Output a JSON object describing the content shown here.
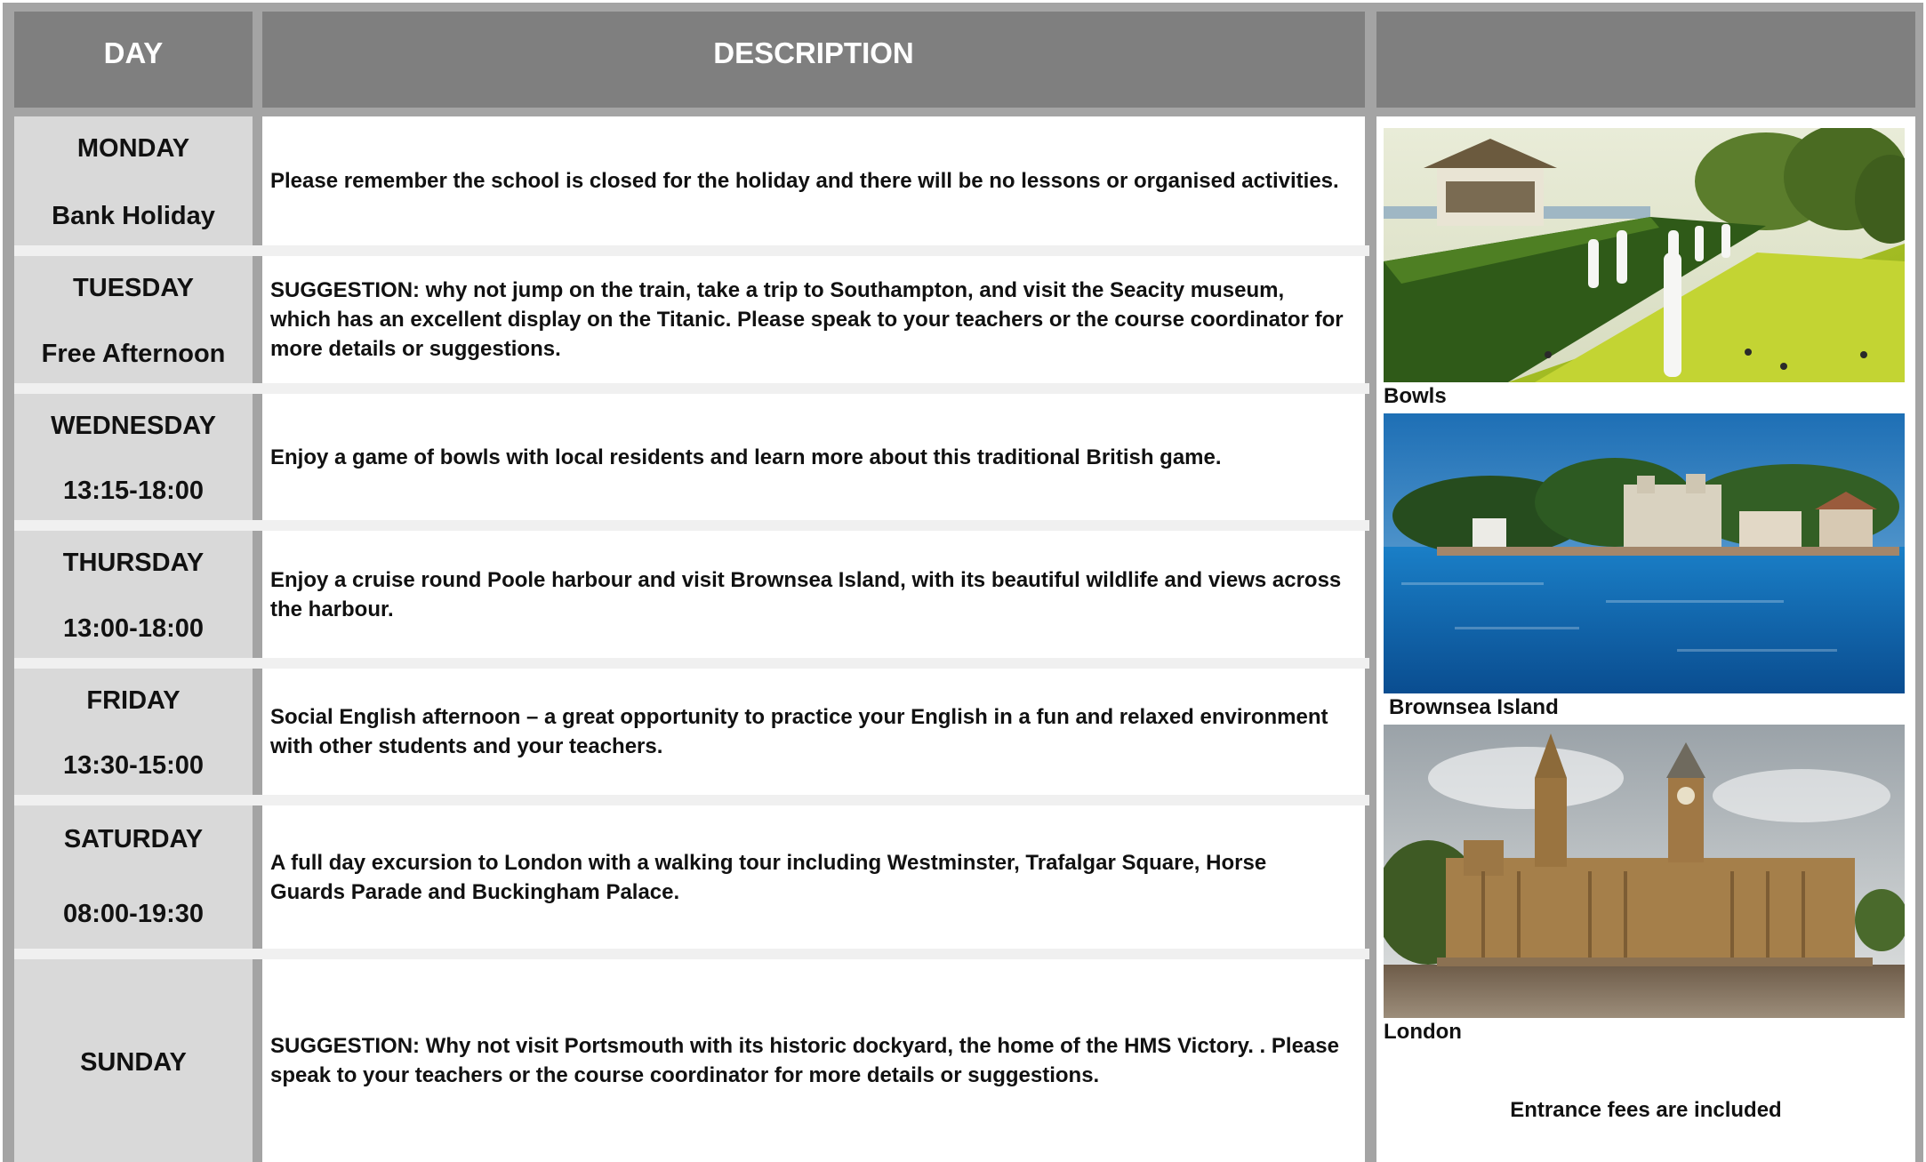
{
  "header": {
    "day": "DAY",
    "description": "DESCRIPTION",
    "pictures": ""
  },
  "rows": [
    {
      "day": "MONDAY",
      "sub": "Bank Holiday",
      "description": "Please remember the school is closed for the holiday and there will be no lessons or organised activities."
    },
    {
      "day": "TUESDAY",
      "sub": "Free Afternoon",
      "description": "SUGGESTION: why not jump on the train, take a trip to Southampton, and visit the Seacity museum, which has an excellent display on the Titanic. Please speak to your teachers or the course coordinator for more details or suggestions."
    },
    {
      "day": "WEDNESDAY",
      "sub": "13:15-18:00",
      "description": "Enjoy a game of bowls with local residents and learn more about this traditional British game."
    },
    {
      "day": "THURSDAY",
      "sub": "13:00-18:00",
      "description": "Enjoy a cruise round Poole harbour and visit Brownsea Island, with its beautiful wildlife and views across the harbour."
    },
    {
      "day": "FRIDAY",
      "sub": "13:30-15:00",
      "description": "Social English afternoon – a great opportunity to practice your English in a fun and relaxed environment with other students and your teachers."
    },
    {
      "day": "SATURDAY",
      "sub": "08:00-19:30",
      "description": "A full day excursion to London with a walking tour including Westminster, Trafalgar Square, Horse Guards Parade and Buckingham Palace."
    },
    {
      "day": "SUNDAY",
      "sub": "",
      "description": "SUGGESTION: Why not visit Portsmouth with its historic dockyard, the home of the HMS Victory. . Please speak to your teachers or the course coordinator for more details or suggestions."
    }
  ],
  "images": [
    {
      "caption": "Bowls",
      "icon": "bowls-photo"
    },
    {
      "caption": "Brownsea Island",
      "icon": "island-photo"
    },
    {
      "caption": "London",
      "icon": "parliament-photo"
    }
  ],
  "note": "Entrance fees are included",
  "colors": {
    "header_bg": "#7f7f7f",
    "day_bg": "#d9d9d9",
    "border": "#a4a4a4"
  }
}
